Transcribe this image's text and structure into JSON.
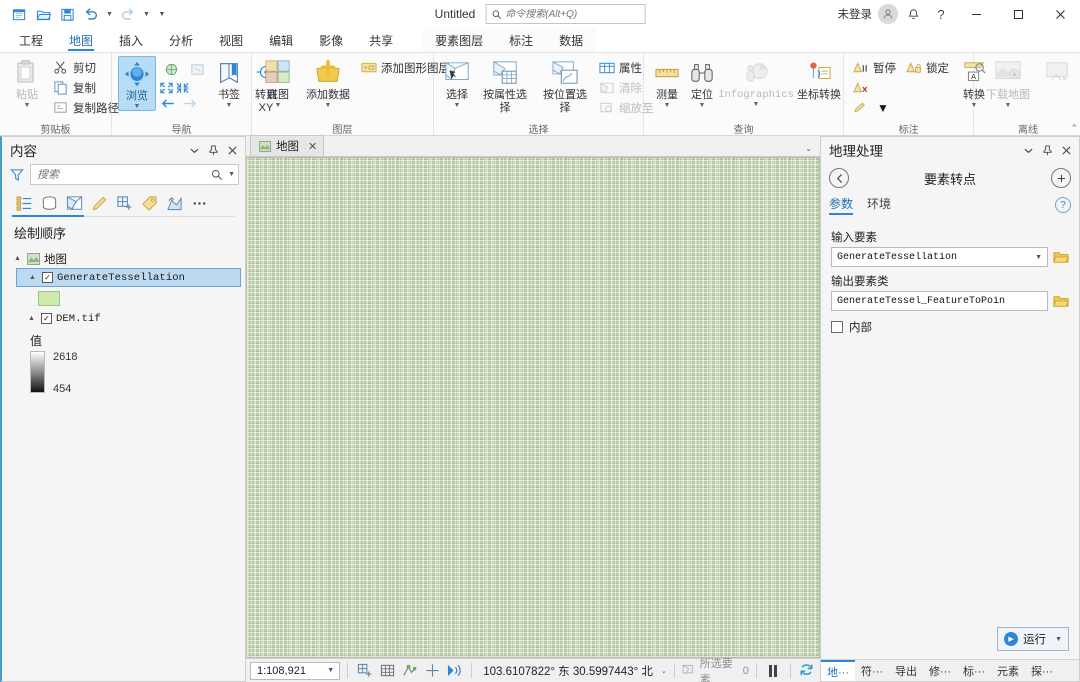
{
  "titlebar": {
    "document_title": "Untitled",
    "search_placeholder": "命令搜索(Alt+Q)",
    "signin_label": "未登录",
    "qat": [
      {
        "name": "new-project-icon",
        "label": "新建工程"
      },
      {
        "name": "open-project-icon",
        "label": "打开工程"
      },
      {
        "name": "save-project-icon",
        "label": "保存工程"
      },
      {
        "name": "undo-icon",
        "label": "撤消"
      },
      {
        "name": "redo-icon",
        "label": "恢复"
      },
      {
        "name": "customize-qat-icon",
        "label": "自定义快速访问工具栏"
      }
    ],
    "window_buttons": {
      "minimize": "–",
      "maximize": "☐",
      "close": "✕"
    },
    "help_label": "?",
    "notification_label": "通知"
  },
  "ribbon_tabs": {
    "main": [
      "工程",
      "地图",
      "插入",
      "分析",
      "视图",
      "编辑",
      "影像",
      "共享"
    ],
    "active": "地图",
    "contextual": [
      "要素图层",
      "标注",
      "数据"
    ]
  },
  "ribbon": {
    "groups": [
      {
        "name": "clipboard",
        "label": "剪贴板",
        "big": [
          {
            "label": "粘贴",
            "dropdown": true,
            "disabled": true
          }
        ],
        "small": [
          {
            "label": "剪切",
            "icon": "scissors-icon"
          },
          {
            "label": "复制",
            "icon": "copy-icon"
          },
          {
            "label": "复制路径",
            "icon": "copy-path-icon"
          }
        ],
        "launcher": false
      },
      {
        "name": "navigate",
        "label": "导航",
        "big": [
          {
            "label": "浏览",
            "dropdown": true,
            "selected": true
          },
          {
            "label": "书签",
            "dropdown": true
          },
          {
            "label": "转到\nXY",
            "dropdown": false
          }
        ],
        "launcher": true
      },
      {
        "name": "layer",
        "label": "图层",
        "big": [
          {
            "label": "底图",
            "dropdown": true
          },
          {
            "label": "添加数据",
            "dropdown": true
          }
        ],
        "small": [
          {
            "label": "添加图形图层",
            "icon": "graphics-layer-icon"
          }
        ],
        "launcher": false
      },
      {
        "name": "selection",
        "label": "选择",
        "big": [
          {
            "label": "选择",
            "dropdown": true
          },
          {
            "label": "按属性选择",
            "dropdown": false
          },
          {
            "label": "按位置选择",
            "dropdown": false
          }
        ],
        "small": [
          {
            "label": "属性",
            "icon": "attribute-table-icon"
          },
          {
            "label": "清除",
            "icon": "clear-selection-icon",
            "disabled": true
          },
          {
            "label": "缩放至",
            "icon": "zoom-to-selection-icon",
            "disabled": true
          }
        ],
        "launcher": true
      },
      {
        "name": "inquiry",
        "label": "查询",
        "big": [
          {
            "label": "测量",
            "dropdown": true
          },
          {
            "label": "定位",
            "dropdown": true
          },
          {
            "label": "Infographics",
            "dropdown": true,
            "disabled": true
          },
          {
            "label": "坐标转换",
            "dropdown": false
          }
        ],
        "launcher": false
      },
      {
        "name": "labeling",
        "label": "标注",
        "big": [
          {
            "label": "转换",
            "dropdown": true
          }
        ],
        "small": [
          {
            "label": "暂停",
            "icon": "pause-labels-icon"
          },
          {
            "label": "锁定",
            "icon": "lock-labels-icon"
          },
          {
            "label": "",
            "icon": "remove-labels-icon"
          },
          {
            "label": "",
            "icon": "label-pencil-icon",
            "dropdown": true
          }
        ],
        "launcher": true
      },
      {
        "name": "offline",
        "label": "离线",
        "big": [
          {
            "label": "下载地图",
            "dropdown": true,
            "disabled": true
          },
          {
            "label": "",
            "dropdown": false,
            "disabled": true
          }
        ],
        "launcher": true
      }
    ],
    "collapse_icon": "chevron-up-icon"
  },
  "contents_panel": {
    "title": "内容",
    "search_placeholder": "搜索",
    "toolbar_icons": [
      "list-by-draw-order-icon",
      "list-by-data-source-icon",
      "list-by-selection-icon",
      "list-by-editing-icon",
      "list-by-snapping-icon",
      "list-by-labeling-icon",
      "list-by-diagram-icon",
      "more-options-icon"
    ],
    "toc_header": "绘制顺序",
    "tree": {
      "map_label": "地图",
      "layers": [
        {
          "label": "GenerateTessellation",
          "checked": true,
          "selected": true,
          "symbol_color": "#cdeab0"
        },
        {
          "label": "DEM.tif",
          "checked": true,
          "selected": false,
          "legend_title": "值",
          "legend_max": "2618",
          "legend_min": "454"
        }
      ]
    },
    "header_buttons": [
      "chevron-down-icon",
      "pin-icon",
      "close-icon"
    ]
  },
  "map_view": {
    "tab_label": "地图",
    "tab_close": "✕",
    "strip_caret": "⌄"
  },
  "statusbar": {
    "scale": "1:108,921",
    "scale_caret": "⌄",
    "tools": [
      "add-grid-icon",
      "grid-icon",
      "snapping-icon",
      "crosshair-icon",
      "measure-nav-icon"
    ],
    "coordinates": "103.6107822°  东  30.5997443°  北",
    "coords_caret": "⌄",
    "selected_features_label": "所选要素",
    "selected_features_count": "0",
    "pause_drawing_icon": "pause-icon",
    "refresh_icon": "refresh-icon"
  },
  "geoprocessing_panel": {
    "title": "地理处理",
    "back_icon": "back-arrow-icon",
    "add_icon": "plus-circle-icon",
    "tool_title": "要素转点",
    "tabs": [
      {
        "label": "参数",
        "active": true
      },
      {
        "label": "环境",
        "active": false
      }
    ],
    "help_icon": "help-circle-icon",
    "fields": [
      {
        "label": "输入要素",
        "value": "GenerateTessellation",
        "has_dropdown": true,
        "has_browse": true
      },
      {
        "label": "输出要素类",
        "value": "GenerateTessel_FeatureToPoin",
        "has_dropdown": false,
        "has_browse": true
      }
    ],
    "checkbox": {
      "label": "内部",
      "checked": false
    },
    "run_button": {
      "label": "运行",
      "caret": "⌄"
    },
    "bottom_tabs": [
      {
        "label": "地···",
        "active": true
      },
      {
        "label": "符···",
        "active": false
      },
      {
        "label": "导出",
        "active": false
      },
      {
        "label": "修···",
        "active": false
      },
      {
        "label": "标···",
        "active": false
      },
      {
        "label": "元素",
        "active": false
      },
      {
        "label": "探···",
        "active": false
      }
    ]
  },
  "colors": {
    "accent": "#2e86d6",
    "panel_bg": "#f5f5f5",
    "map_green": "#b9cba3",
    "selection_blue": "#bcd9f0",
    "layer_swatch": "#cdeab0"
  }
}
